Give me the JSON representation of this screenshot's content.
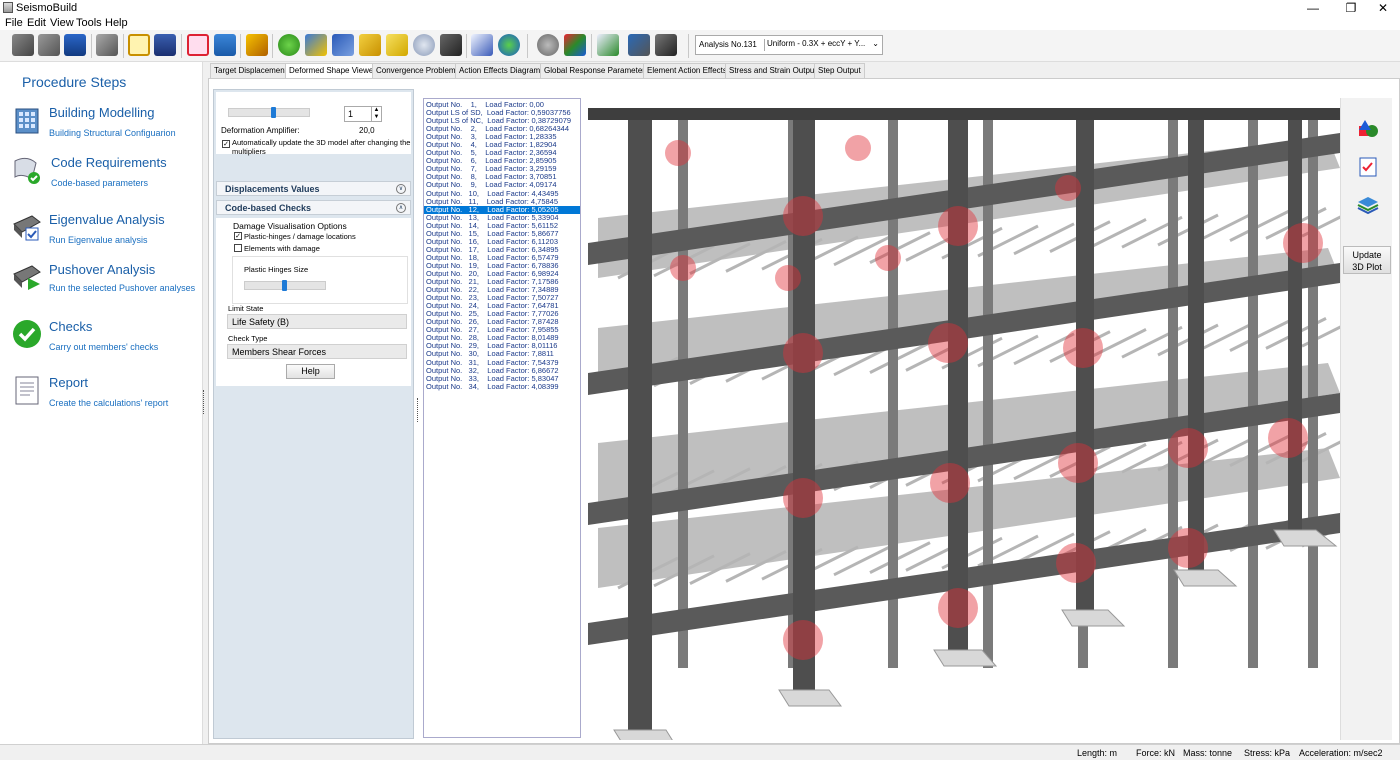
{
  "window": {
    "title": "SeismoBuild",
    "minimize": "—",
    "maximize": "❐",
    "close": "✕"
  },
  "menu": [
    "File",
    "Edit",
    "View",
    "Tools",
    "Help"
  ],
  "toolbar": {
    "icons": [
      "new-file-icon",
      "open-icon",
      "save-icon",
      "building-icon",
      "frame-icon",
      "report-icon",
      "structure-icon",
      "calculator-icon",
      "brush-icon",
      "help-icon",
      "books-icon",
      "books-2-icon",
      "folder-icon",
      "notes-icon",
      "chat-icon",
      "film-icon",
      "pen-icon",
      "globe-icon",
      "settings-icon",
      "shapes-icon",
      "checklist-icon",
      "layers-icon",
      "film-2-icon"
    ],
    "analysis_label": "Analysis No.131",
    "analysis_value": "Uniform  - 0.3X + eccY + Y..."
  },
  "procedure": {
    "title": "Procedure Steps",
    "steps": [
      {
        "title": "Building Modelling",
        "subtitle": "Building Structural Configuarion",
        "icon": "building-modelling-icon"
      },
      {
        "title": "Code Requirements",
        "subtitle": "Code-based parameters",
        "icon": "code-requirements-icon"
      },
      {
        "title": "Eigenvalue Analysis",
        "subtitle": "Run Eigenvalue analysis",
        "icon": "eigenvalue-icon"
      },
      {
        "title": "Pushover Analysis",
        "subtitle": "Run the selected Pushover analyses",
        "icon": "pushover-icon"
      },
      {
        "title": "Checks",
        "subtitle": "Carry out members' checks",
        "icon": "checks-icon"
      },
      {
        "title": "Report",
        "subtitle": "Create the calculations' report",
        "icon": "report-doc-icon"
      }
    ]
  },
  "tabs": [
    "Target Displacement",
    "Deformed Shape Viewer",
    "Convergence Problems",
    "Action Effects Diagrams",
    "Global Response Parameters",
    "Element Action Effects",
    "Stress and Strain Output",
    "Step Output"
  ],
  "active_tab": 1,
  "options": {
    "spin_value": "1",
    "deformation_label": "Deformation Amplifier:",
    "deformation_value": "20,0",
    "auto_update_label": "Automatically update the 3D model after changing the multipliers",
    "auto_update_checked": true,
    "displacements_header": "Displacements Values",
    "code_checks_header": "Code-based Checks",
    "damage_group": "Damage Visualisation Options",
    "plastic_hinges_label": "Plastic-hinges / damage locations",
    "plastic_hinges_checked": true,
    "elements_damage_label": "Elements with damage",
    "elements_damage_checked": false,
    "hinge_size_label": "Plastic Hinges Size",
    "limit_state_label": "Limit State",
    "limit_state_value": "Life Safety (B)",
    "check_type_label": "Check Type",
    "check_type_value": "Members Shear Forces",
    "help_label": "Help"
  },
  "outputs": {
    "selected_index": 13,
    "rows": [
      "Output No.    1,    Load Factor: 0,00",
      "Output LS of SD,  Load Factor: 0,59037756",
      "Output LS of NC,  Load Factor: 0,38729079",
      "Output No.    2,    Load Factor: 0,68264344",
      "Output No.    3,    Load Factor: 1,28335",
      "Output No.    4,    Load Factor: 1,82904",
      "Output No.    5,    Load Factor: 2,36594",
      "Output No.    6,    Load Factor: 2,85905",
      "Output No.    7,    Load Factor: 3,29159",
      "Output No.    8,    Load Factor: 3,70851",
      "Output No.    9,    Load Factor: 4,09174",
      "Output No.   10,    Load Factor: 4,43495",
      "Output No.   11,    Load Factor: 4,75845",
      "Output No.   12,    Load Factor: 5,05205",
      "Output No.   13,    Load Factor: 5,33904",
      "Output No.   14,    Load Factor: 5,61152",
      "Output No.   15,    Load Factor: 5,86677",
      "Output No.   16,    Load Factor: 6,11203",
      "Output No.   17,    Load Factor: 6,34895",
      "Output No.   18,    Load Factor: 6,57479",
      "Output No.   19,    Load Factor: 6,78836",
      "Output No.   20,    Load Factor: 6,98924",
      "Output No.   21,    Load Factor: 7,17586",
      "Output No.   22,    Load Factor: 7,34889",
      "Output No.   23,    Load Factor: 7,50727",
      "Output No.   24,    Load Factor: 7,64781",
      "Output No.   25,    Load Factor: 7,77026",
      "Output No.   26,    Load Factor: 7,87428",
      "Output No.   27,    Load Factor: 7,95855",
      "Output No.   28,    Load Factor: 8,01489",
      "Output No.   29,    Load Factor: 8,01116",
      "Output No.   30,    Load Factor: 7,8811",
      "Output No.   31,    Load Factor: 7,54379",
      "Output No.   32,    Load Factor: 6,86672",
      "Output No.   33,    Load Factor: 5,83047",
      "Output No.   34,    Load Factor: 4,08399"
    ]
  },
  "sidetools": {
    "update_label_1": "Update",
    "update_label_2": "3D Plot"
  },
  "status": {
    "length": "Length: m",
    "force": "Force: kN",
    "mass": "Mass: tonne",
    "stress": "Stress: kPa",
    "acceleration": "Acceleration: m/sec2"
  },
  "colors": {
    "accent": "#1a5fa8",
    "selection": "#0078d7",
    "hinge": "#e0303a",
    "structure": "#5a5a5a"
  }
}
